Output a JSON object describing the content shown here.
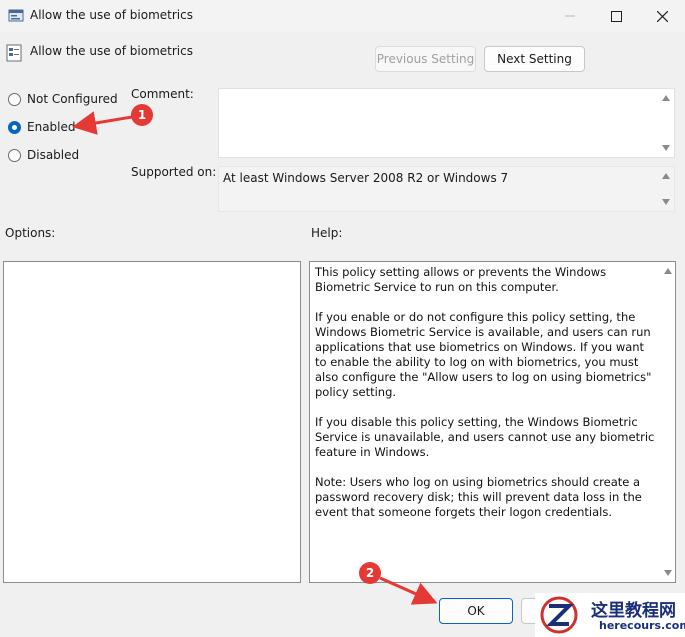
{
  "window": {
    "title": "Allow the use of biometrics"
  },
  "header": {
    "policy_title": "Allow the use of biometrics",
    "previous_label": "Previous Setting",
    "next_label": "Next Setting"
  },
  "state": {
    "options": [
      {
        "label": "Not Configured",
        "checked": false
      },
      {
        "label": "Enabled",
        "checked": true
      },
      {
        "label": "Disabled",
        "checked": false
      }
    ]
  },
  "comment": {
    "label": "Comment:",
    "value": ""
  },
  "supported": {
    "label": "Supported on:",
    "value": "At least Windows Server 2008 R2 or Windows 7"
  },
  "options_pane": {
    "label": "Options:"
  },
  "help_pane": {
    "label": "Help:",
    "paragraphs": [
      "This policy setting allows or prevents the Windows Biometric Service to run on this computer.",
      "If you enable or do not configure this policy setting, the Windows Biometric Service is available, and users can run applications that use biometrics on Windows. If you want to enable the ability to log on with biometrics, you must also configure the \"Allow users to log on using biometrics\" policy setting.",
      "If you disable this policy setting, the Windows Biometric Service is unavailable, and users cannot use any biometric feature in Windows.",
      "Note: Users who log on using biometrics should create a password recovery disk; this will prevent data loss in the event that someone forgets their logon credentials."
    ]
  },
  "footer": {
    "ok_label": "OK"
  },
  "annotations": {
    "badge1": "1",
    "badge2": "2",
    "color": "#e53935"
  },
  "watermark": {
    "cn": "这里教程网",
    "en": "herecours.com"
  }
}
